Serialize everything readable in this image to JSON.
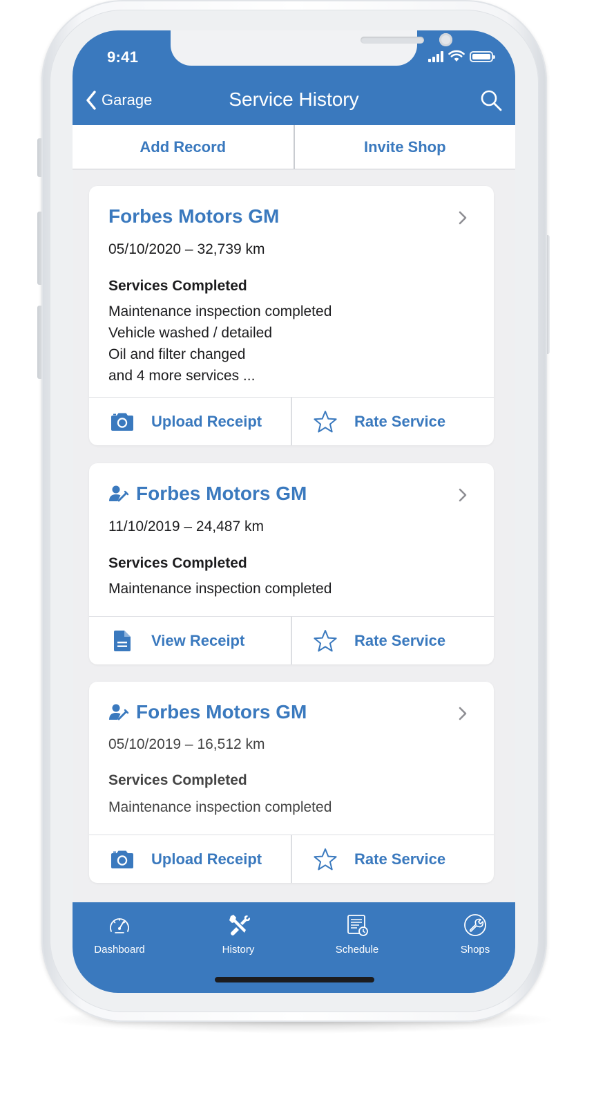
{
  "status": {
    "time": "9:41"
  },
  "nav": {
    "back_label": "Garage",
    "title": "Service History"
  },
  "top_actions": {
    "add_record": "Add Record",
    "invite_shop": "Invite Shop"
  },
  "records": [
    {
      "shop": "Forbes Motors GM",
      "meta": "05/10/2020 – 32,739 km",
      "services_heading": "Services Completed",
      "services": [
        "Maintenance inspection completed",
        "Vehicle washed / detailed",
        "Oil and filter changed",
        "and 4 more services ..."
      ],
      "action_left": "Upload Receipt",
      "action_right": "Rate Service"
    },
    {
      "shop": "Forbes Motors GM",
      "meta": "11/10/2019 – 24,487 km",
      "services_heading": "Services Completed",
      "services": [
        "Maintenance inspection completed"
      ],
      "action_left": "View Receipt",
      "action_right": "Rate Service"
    },
    {
      "shop": "Forbes Motors GM",
      "meta": "05/10/2019 – 16,512 km",
      "services_heading": "Services Completed",
      "services": [
        "Maintenance inspection completed"
      ],
      "action_left": "Upload Receipt",
      "action_right": "Rate Service"
    }
  ],
  "tabs": [
    {
      "label": "Dashboard",
      "icon": "speedometer-icon"
    },
    {
      "label": "History",
      "icon": "tools-icon"
    },
    {
      "label": "Schedule",
      "icon": "schedule-icon"
    },
    {
      "label": "Shops",
      "icon": "wrench-icon"
    }
  ],
  "colors": {
    "brand": "#3a79be",
    "background": "#efeff1",
    "card": "#ffffff"
  }
}
